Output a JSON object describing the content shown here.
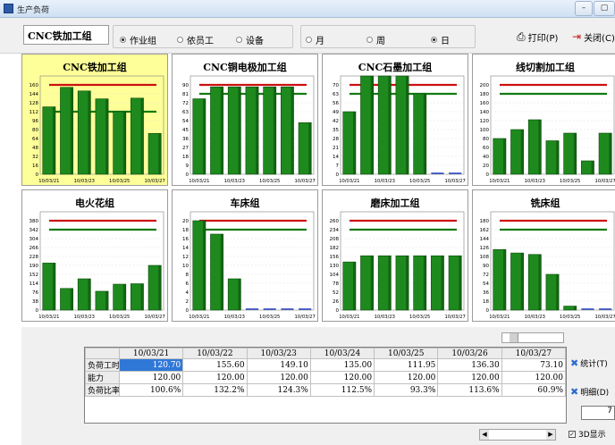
{
  "window": {
    "title": "生产负荷"
  },
  "toolbar": {
    "group_value": "CNC铁加工组",
    "dim_options": [
      {
        "label": "作业组",
        "checked": true
      },
      {
        "label": "依员工",
        "checked": false
      },
      {
        "label": "设备",
        "checked": false
      }
    ],
    "period_options": [
      {
        "label": "月",
        "checked": false
      },
      {
        "label": "周",
        "checked": false
      },
      {
        "label": "日",
        "checked": true
      }
    ],
    "print_label": "打印(P)",
    "close_label": "关闭(C)"
  },
  "colors": {
    "bar": "#1e8a1e",
    "bar_dark": "#0a4a0a",
    "cap_line": "#cc1010",
    "load_line": "#137a13",
    "selected_panel": "#ffff99",
    "selected_cell": "#3078d8"
  },
  "chart_data": [
    {
      "type": "bar",
      "title": "CNC铁加工组",
      "categories": [
        "10/03/21",
        "10/03/23",
        "10/03/25",
        "10/03/27"
      ],
      "values": [
        120.7,
        155.6,
        149.1,
        135.0,
        112.0,
        136.3,
        73.1
      ],
      "ylim": [
        0,
        176
      ],
      "yticks": [
        0,
        16,
        32,
        48,
        64,
        80,
        96,
        112,
        128,
        144,
        160
      ],
      "capacity": 160,
      "load": 112
    },
    {
      "type": "bar",
      "title": "CNC铜电极加工组",
      "categories": [
        "10/03/21",
        "10/03/23",
        "10/03/25",
        "10/03/27"
      ],
      "values": [
        76,
        88,
        88,
        88,
        88,
        88,
        52
      ],
      "ylim": [
        0,
        99
      ],
      "yticks": [
        0,
        9,
        18,
        27,
        36,
        45,
        54,
        63,
        72,
        81,
        90
      ],
      "capacity": 90,
      "load": 81
    },
    {
      "type": "bar",
      "title": "CNC石墨加工组",
      "categories": [
        "10/03/21",
        "10/03/23",
        "10/03/25",
        "10/03/27"
      ],
      "values": [
        49,
        77,
        77,
        77,
        63,
        0,
        0
      ],
      "ylim": [
        0,
        77
      ],
      "yticks": [
        0,
        7,
        14,
        21,
        28,
        35,
        42,
        49,
        56,
        63,
        70
      ],
      "capacity": 70,
      "load": 63
    },
    {
      "type": "bar",
      "title": "线切割加工组",
      "categories": [
        "10/03/21",
        "10/03/23",
        "10/03/25",
        "10/03/27"
      ],
      "values": [
        80,
        100,
        122,
        75,
        92,
        30,
        92
      ],
      "ylim": [
        0,
        220
      ],
      "yticks": [
        0,
        20,
        40,
        60,
        80,
        100,
        120,
        140,
        160,
        180,
        200
      ],
      "capacity": 200,
      "load": 180
    },
    {
      "type": "bar",
      "title": "电火花组",
      "categories": [
        "10/03/21",
        "10/03/23",
        "10/03/25",
        "10/03/27"
      ],
      "values": [
        200,
        92,
        133,
        80,
        110,
        112,
        190
      ],
      "ylim": [
        0,
        418
      ],
      "yticks": [
        0,
        38,
        76,
        114,
        152,
        190,
        228,
        266,
        304,
        342,
        380
      ],
      "capacity": 380,
      "load": 342
    },
    {
      "type": "bar",
      "title": "车床组",
      "categories": [
        "10/03/21",
        "10/03/23",
        "10/03/25",
        "10/03/27"
      ],
      "values": [
        20,
        17,
        7,
        0,
        0,
        0,
        0
      ],
      "ylim": [
        0,
        22
      ],
      "yticks": [
        0,
        2,
        4,
        6,
        8,
        10,
        12,
        14,
        16,
        18,
        20
      ],
      "capacity": 20,
      "load": 18
    },
    {
      "type": "bar",
      "title": "磨床加工组",
      "categories": [
        "10/03/21",
        "10/03/23",
        "10/03/25",
        "10/03/27"
      ],
      "values": [
        140,
        158,
        158,
        158,
        158,
        158,
        158
      ],
      "ylim": [
        0,
        286
      ],
      "yticks": [
        0,
        26,
        52,
        78,
        104,
        130,
        156,
        182,
        208,
        234,
        260
      ],
      "capacity": 260,
      "load": 234
    },
    {
      "type": "bar",
      "title": "铣床组",
      "categories": [
        "10/03/21",
        "10/03/23",
        "10/03/25",
        "10/03/27"
      ],
      "values": [
        122,
        115,
        112,
        72,
        8,
        0,
        0
      ],
      "ylim": [
        0,
        198
      ],
      "yticks": [
        0,
        18,
        36,
        54,
        72,
        90,
        108,
        126,
        144,
        162,
        180
      ],
      "capacity": 180,
      "load": 162
    }
  ],
  "table": {
    "columns": [
      "10/03/21",
      "10/03/22",
      "10/03/23",
      "10/03/24",
      "10/03/25",
      "10/03/26",
      "10/03/27"
    ],
    "rows": [
      {
        "label": "负荷工时",
        "values": [
          "120.70",
          "155.60",
          "149.10",
          "135.00",
          "111.95",
          "136.30",
          "73.10"
        ]
      },
      {
        "label": "能力",
        "values": [
          "120.00",
          "120.00",
          "120.00",
          "120.00",
          "120.00",
          "120.00",
          "120.00"
        ]
      },
      {
        "label": "负荷比率",
        "values": [
          "100.6%",
          "132.2%",
          "124.3%",
          "112.5%",
          "93.3%",
          "113.6%",
          "60.9%"
        ]
      }
    ]
  },
  "side": {
    "stats_label": "统计(T)",
    "detail_label": "明细(D)",
    "number_value": "7",
    "check3d_label": "3D显示",
    "check3d_on": true
  }
}
